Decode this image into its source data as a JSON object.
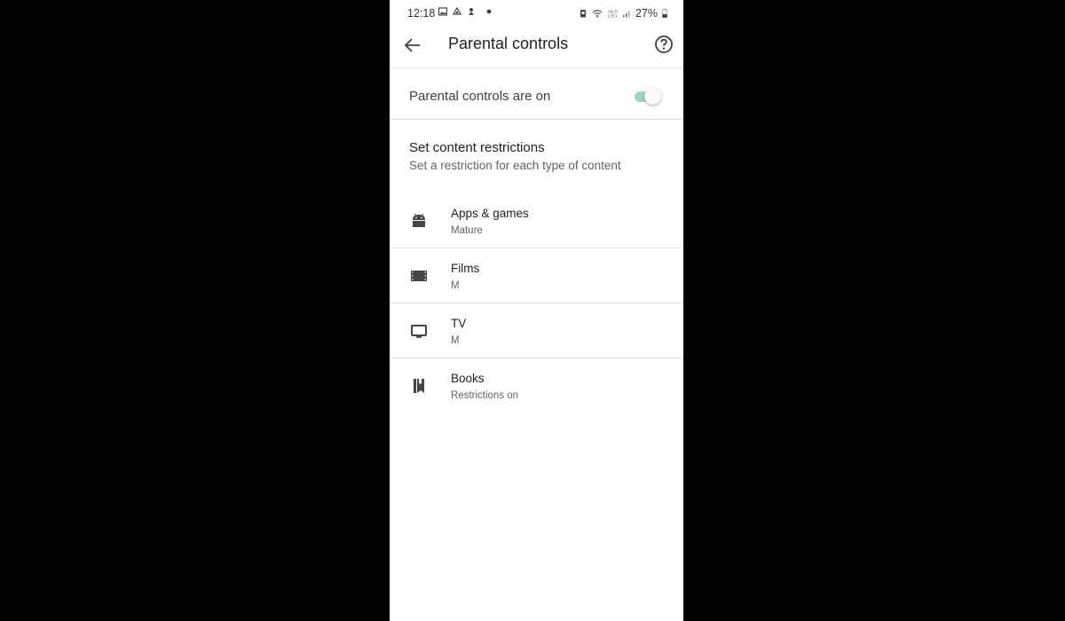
{
  "status_bar": {
    "time": "12:18",
    "left_icons": [
      "gallery-icon",
      "drive-icon",
      "notification-icon",
      "dot-icon"
    ],
    "right_icons": [
      "battery-saver-icon",
      "wifi-icon",
      "volte-lte-icon",
      "signal-icon"
    ],
    "battery": "27%"
  },
  "app_bar": {
    "title": "Parental controls",
    "back_icon": "arrow-left-icon",
    "help_icon": "help-circle-icon"
  },
  "parental_toggle": {
    "label": "Parental controls are on",
    "on": true,
    "accent_color": "#9fd4c4"
  },
  "restrictions": {
    "heading": "Set content restrictions",
    "subheading": "Set a restriction for each type of content",
    "items": [
      {
        "icon": "android-icon",
        "title": "Apps & games",
        "value": "Mature"
      },
      {
        "icon": "film-icon",
        "title": "Films",
        "value": "M"
      },
      {
        "icon": "tv-icon",
        "title": "TV",
        "value": "M"
      },
      {
        "icon": "books-icon",
        "title": "Books",
        "value": "Restrictions on"
      }
    ]
  }
}
